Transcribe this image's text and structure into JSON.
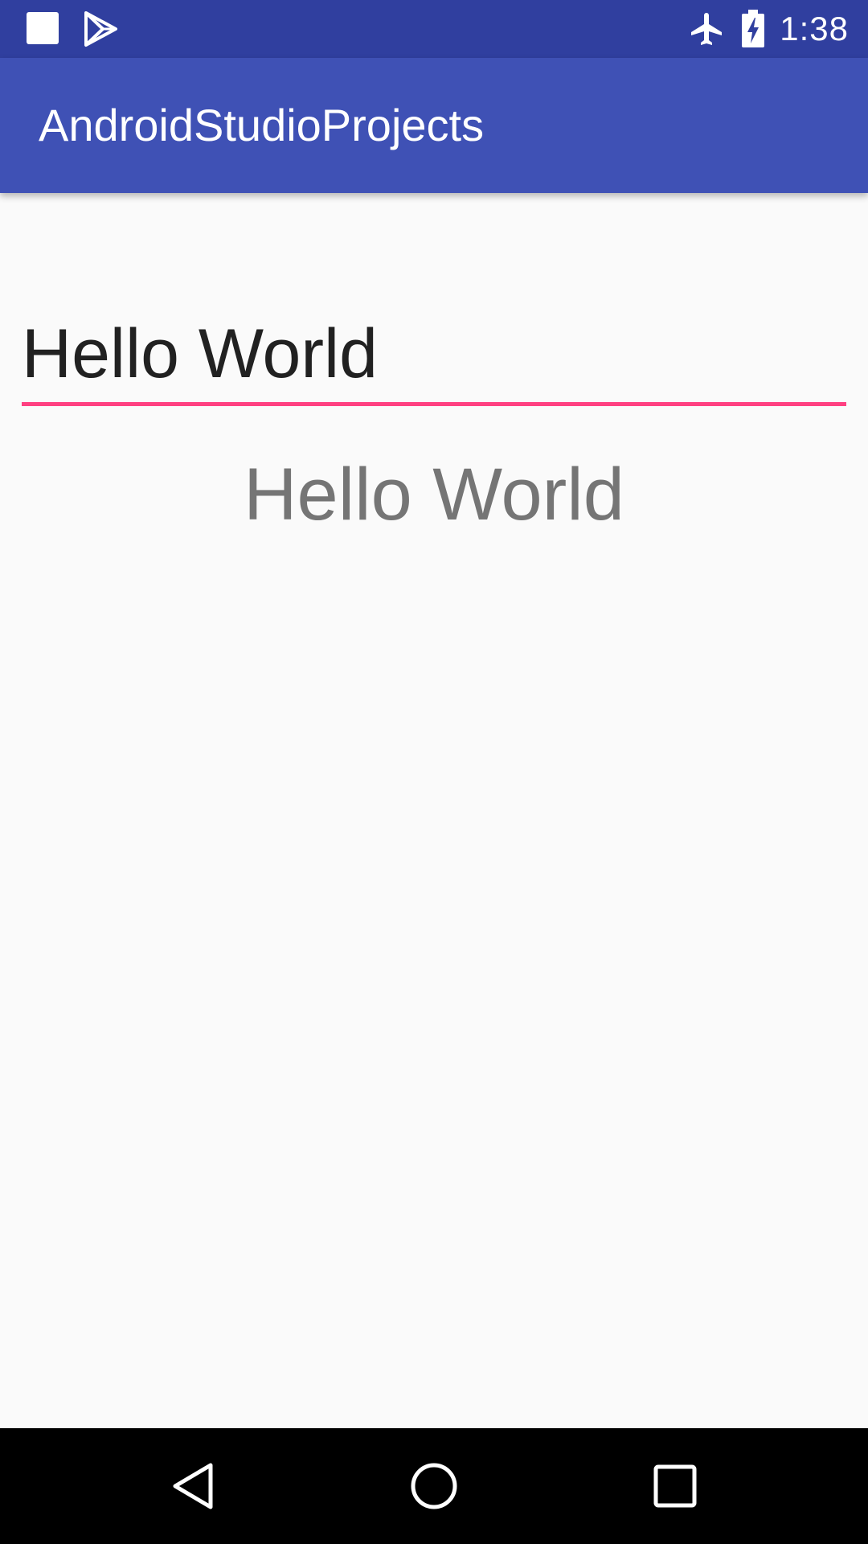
{
  "status_bar": {
    "time": "1:38",
    "icons": [
      "notification-square-icon",
      "play-store-icon",
      "airplane-mode-icon",
      "battery-charging-icon"
    ]
  },
  "app_bar": {
    "title": "AndroidStudioProjects"
  },
  "main": {
    "edit_text_value": "Hello World",
    "edit_text_placeholder": "",
    "text_view": "Hello World"
  },
  "nav_bar": {
    "buttons": [
      "back",
      "home",
      "recents"
    ]
  },
  "colors": {
    "status_bar": "#303f9f",
    "app_bar": "#3f51b5",
    "accent": "#ff4081",
    "background": "#fafafa",
    "nav_bar": "#000000"
  }
}
